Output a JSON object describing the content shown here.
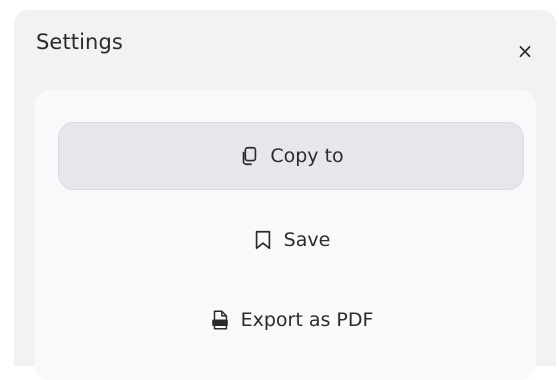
{
  "dialog": {
    "title": "Settings",
    "close_glyph": "×"
  },
  "menu": {
    "items": [
      {
        "label": "Copy to",
        "icon": "copy-icon",
        "active": true
      },
      {
        "label": "Save",
        "icon": "bookmark-icon",
        "active": false
      },
      {
        "label": "Export as PDF",
        "icon": "pdf-file-icon",
        "active": false
      }
    ]
  },
  "colors": {
    "panel_bg": "#f1f2f4",
    "card_bg": "#f8f9fb",
    "active_item_bg": "#e6e7ea",
    "text": "#2b2b2b"
  }
}
